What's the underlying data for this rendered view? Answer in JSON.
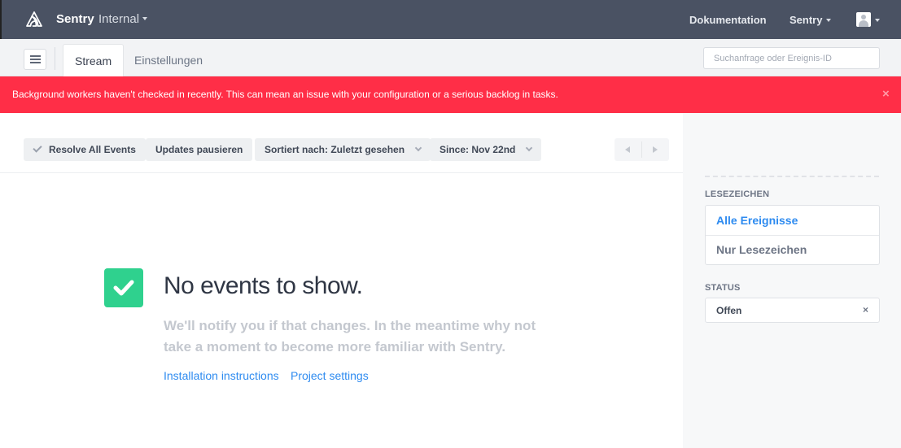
{
  "header": {
    "brand": "Sentry",
    "org": "Internal",
    "docs_link": "Dokumentation",
    "user_menu": "Sentry"
  },
  "subnav": {
    "tabs": [
      {
        "label": "Stream",
        "active": true
      },
      {
        "label": "Einstellungen",
        "active": false
      }
    ],
    "search_placeholder": "Suchanfrage oder Ereignis-ID"
  },
  "alert": {
    "text": "Background workers haven't checked in recently. This can mean an issue with your configuration or a serious backlog in tasks.",
    "close": "×",
    "color": "#ff2e47"
  },
  "toolbar": {
    "resolve_all": "Resolve All Events",
    "pause": "Updates pausieren",
    "sort": "Sortiert nach: Zuletzt gesehen",
    "since": "Since: Nov 22nd"
  },
  "empty_state": {
    "title": "No events to show.",
    "text": "We'll notify you if that changes. In the meantime why not take a moment to become more familiar with Sentry.",
    "links": {
      "install": "Installation instructions",
      "project": "Project settings"
    },
    "icon_color": "#2fd18e"
  },
  "sidebar": {
    "bookmarks_heading": "LESEZEICHEN",
    "bookmarks": [
      {
        "label": "Alle Ereignisse",
        "active": true
      },
      {
        "label": "Nur Lesezeichen",
        "active": false
      }
    ],
    "status_heading": "STATUS",
    "status_value": "Offen",
    "status_clear": "×"
  },
  "colors": {
    "header_bg": "#4a5263",
    "link": "#2e8bf0"
  }
}
